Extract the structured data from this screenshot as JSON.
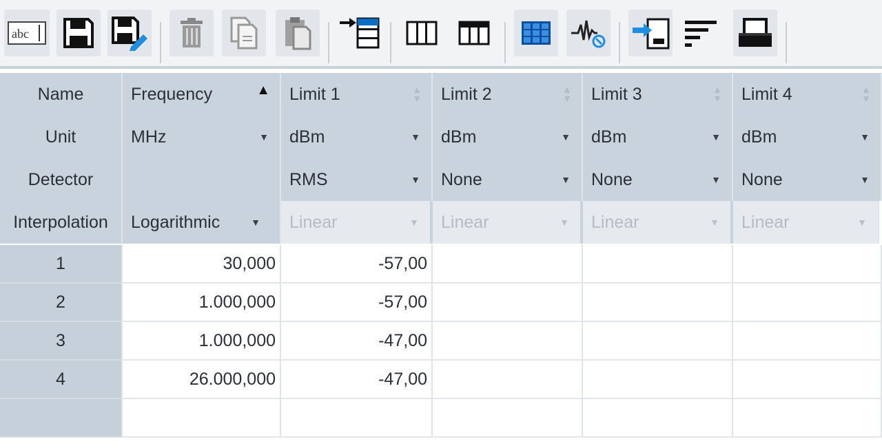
{
  "toolbar": {
    "buttons": [
      {
        "icon": "rename-icon",
        "label": "abc"
      },
      {
        "icon": "save-icon"
      },
      {
        "icon": "save-as-icon"
      },
      {
        "icon": "delete-icon"
      },
      {
        "icon": "copy-icon"
      },
      {
        "icon": "paste-icon"
      },
      {
        "icon": "insert-row-icon"
      },
      {
        "icon": "columns-icon"
      },
      {
        "icon": "table-header-icon"
      },
      {
        "icon": "grid-view-icon"
      },
      {
        "icon": "waveform-icon"
      },
      {
        "icon": "import-icon"
      },
      {
        "icon": "sort-icon"
      },
      {
        "icon": "print-icon"
      }
    ]
  },
  "table": {
    "header_rows": {
      "name": {
        "label": "Name",
        "cols": [
          "Frequency",
          "Limit 1",
          "Limit 2",
          "Limit 3",
          "Limit 4"
        ]
      },
      "unit": {
        "label": "Unit",
        "cols": [
          "MHz",
          "dBm",
          "dBm",
          "dBm",
          "dBm"
        ]
      },
      "detector": {
        "label": "Detector",
        "cols": [
          "",
          "RMS",
          "None",
          "None",
          "None"
        ]
      },
      "interpolation": {
        "label": "Interpolation",
        "cols": [
          "Logarithmic",
          "Linear",
          "Linear",
          "Linear",
          "Linear"
        ]
      }
    },
    "rows": [
      {
        "index": "1",
        "frequency": "30,000",
        "limit1": "-57,00",
        "limit2": "",
        "limit3": "",
        "limit4": ""
      },
      {
        "index": "2",
        "frequency": "1.000,000",
        "limit1": "-57,00",
        "limit2": "",
        "limit3": "",
        "limit4": ""
      },
      {
        "index": "3",
        "frequency": "1.000,000",
        "limit1": "-47,00",
        "limit2": "",
        "limit3": "",
        "limit4": ""
      },
      {
        "index": "4",
        "frequency": "26.000,000",
        "limit1": "-47,00",
        "limit2": "",
        "limit3": "",
        "limit4": ""
      },
      {
        "index": "",
        "frequency": "",
        "limit1": "",
        "limit2": "",
        "limit3": "",
        "limit4": ""
      }
    ]
  },
  "colors": {
    "header_bg": "#c9d3de",
    "accent_blue": "#0a6fc2",
    "toolbar_bg": "#f1f3f5"
  }
}
